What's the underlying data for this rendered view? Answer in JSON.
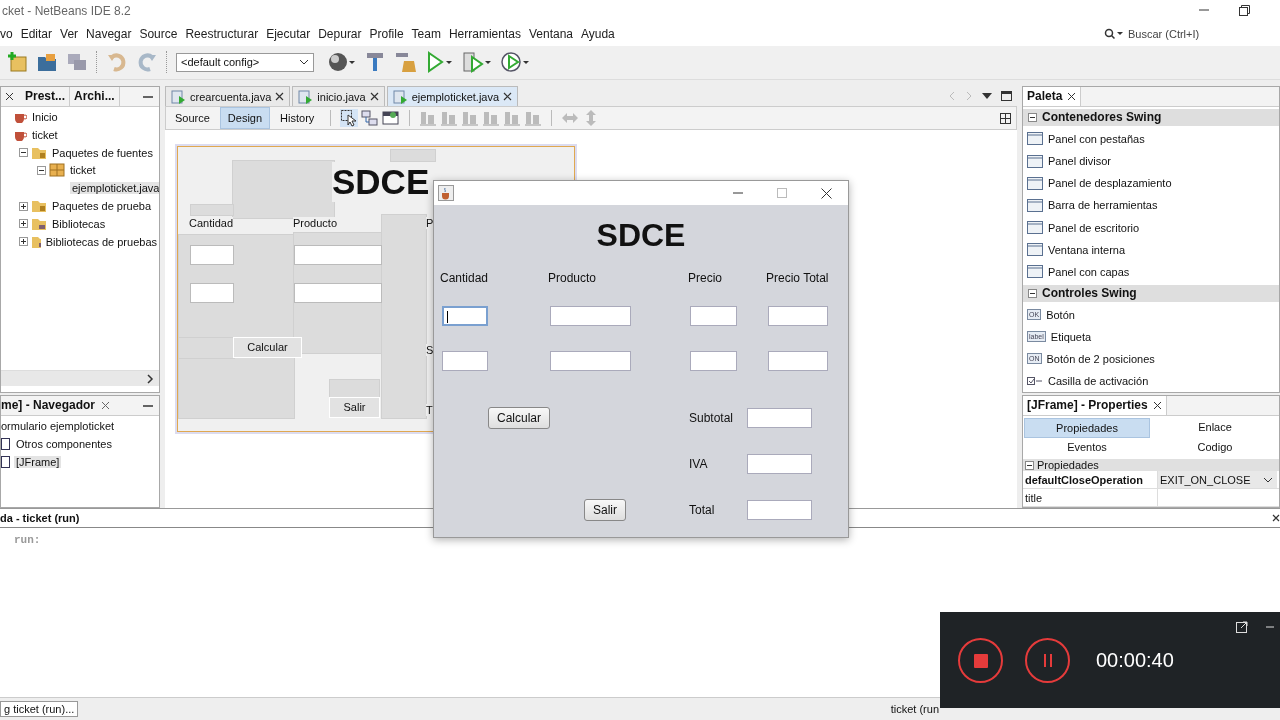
{
  "window": {
    "title": "cket - NetBeans IDE 8.2"
  },
  "menu": [
    "vo",
    "Editar",
    "Ver",
    "Navegar",
    "Source",
    "Reestructurar",
    "Ejecutar",
    "Depurar",
    "Profile",
    "Team",
    "Herramientas",
    "Ventana",
    "Ayuda"
  ],
  "search": {
    "placeholder": "Buscar (Ctrl+I)"
  },
  "toolbar": {
    "config": "<default config>"
  },
  "left_tabs": [
    {
      "label": "Prest..."
    },
    {
      "label": "Archi..."
    }
  ],
  "project_tree": [
    {
      "label": "Inicio",
      "kind": "project"
    },
    {
      "label": "ticket",
      "kind": "project",
      "children": [
        {
          "label": "Paquetes de fuentes",
          "kind": "folder",
          "expanded": true,
          "children": [
            {
              "label": "ticket",
              "kind": "package",
              "expanded": true,
              "children": [
                {
                  "label": "ejemploticket.java",
                  "kind": "java",
                  "selected": true
                }
              ]
            }
          ]
        },
        {
          "label": "Paquetes de prueba",
          "kind": "folder",
          "expanded": false
        },
        {
          "label": "Bibliotecas",
          "kind": "library",
          "expanded": false
        },
        {
          "label": "Bibliotecas de pruebas",
          "kind": "library",
          "expanded": false
        }
      ]
    }
  ],
  "navigator": {
    "title": "me] - Navegador",
    "tree": [
      {
        "label": "ormulario ejemploticket",
        "kind": "form",
        "children": [
          {
            "label": "Otros componentes",
            "kind": "component",
            "selected": false
          },
          {
            "label": "[JFrame]",
            "kind": "component",
            "selected": true
          }
        ]
      }
    ]
  },
  "editor_tabs": [
    {
      "label": "crearcuenta.java",
      "selected": false
    },
    {
      "label": "inicio.java",
      "selected": false
    },
    {
      "label": "ejemploticket.java",
      "selected": true
    }
  ],
  "view_tabs": [
    {
      "label": "Source",
      "selected": false
    },
    {
      "label": "Design",
      "selected": true
    },
    {
      "label": "History",
      "selected": false
    }
  ],
  "designer": {
    "heading": "SDCE",
    "labels": [
      "Cantidad",
      "Producto",
      "P",
      "S",
      "T"
    ],
    "buttons": [
      "Calcular",
      "Salir"
    ]
  },
  "palette": {
    "title": "Paleta",
    "categories": [
      {
        "label": "Contenedores Swing",
        "expanded": true,
        "items": [
          {
            "label": "Panel con pestañas",
            "kind": "container"
          },
          {
            "label": "Panel divisor",
            "kind": "container"
          },
          {
            "label": "Panel de desplazamiento",
            "kind": "container"
          },
          {
            "label": "Barra de herramientas",
            "kind": "container"
          },
          {
            "label": "Panel de escritorio",
            "kind": "container"
          },
          {
            "label": "Ventana interna",
            "kind": "container"
          },
          {
            "label": "Panel con capas",
            "kind": "container"
          }
        ]
      },
      {
        "label": "Controles Swing",
        "expanded": true,
        "items": [
          {
            "label": "Botón",
            "kind": "text_control",
            "icon_text": "OK"
          },
          {
            "label": "Etiqueta",
            "kind": "text_control",
            "icon_text": "label"
          },
          {
            "label": "Botón de 2 posiciones",
            "kind": "text_control",
            "icon_text": "ON"
          },
          {
            "label": "Casilla de activación",
            "kind": "checkbox"
          }
        ]
      }
    ]
  },
  "properties": {
    "title": "[JFrame] - Properties",
    "tabs": [
      {
        "label": "Propiedades",
        "selected": true
      },
      {
        "label": "Enlace",
        "selected": false
      },
      {
        "label": "Eventos",
        "selected": false
      },
      {
        "label": "Codigo",
        "selected": false
      }
    ],
    "section": "Propiedades",
    "rows": [
      {
        "name": "defaultCloseOperation",
        "value": "EXIT_ON_CLOSE",
        "kind": "dropdown"
      },
      {
        "name": "title",
        "kind": "text"
      }
    ]
  },
  "output": {
    "title": "da - ticket (run)",
    "lines": [
      "run:"
    ]
  },
  "status_bar": {
    "task": "g ticket (run)...",
    "right": "ticket (run"
  },
  "dialog": {
    "heading": "SDCE",
    "columns": [
      "Cantidad",
      "Producto",
      "Precio",
      "Precio Total"
    ],
    "rows": [
      [
        {
          "focused": true
        },
        {
          "focused": false
        },
        {
          "focused": false
        },
        {
          "focused": false
        }
      ],
      [
        {
          "focused": false
        },
        {
          "focused": false
        },
        {
          "focused": false
        },
        {
          "focused": false
        }
      ]
    ],
    "summary": [
      {
        "label": "Subtotal"
      },
      {
        "label": "IVA"
      },
      {
        "label": "Total"
      }
    ],
    "buttons": [
      "Calcular",
      "Salir"
    ]
  },
  "recorder": {
    "time": "00:00:40"
  }
}
